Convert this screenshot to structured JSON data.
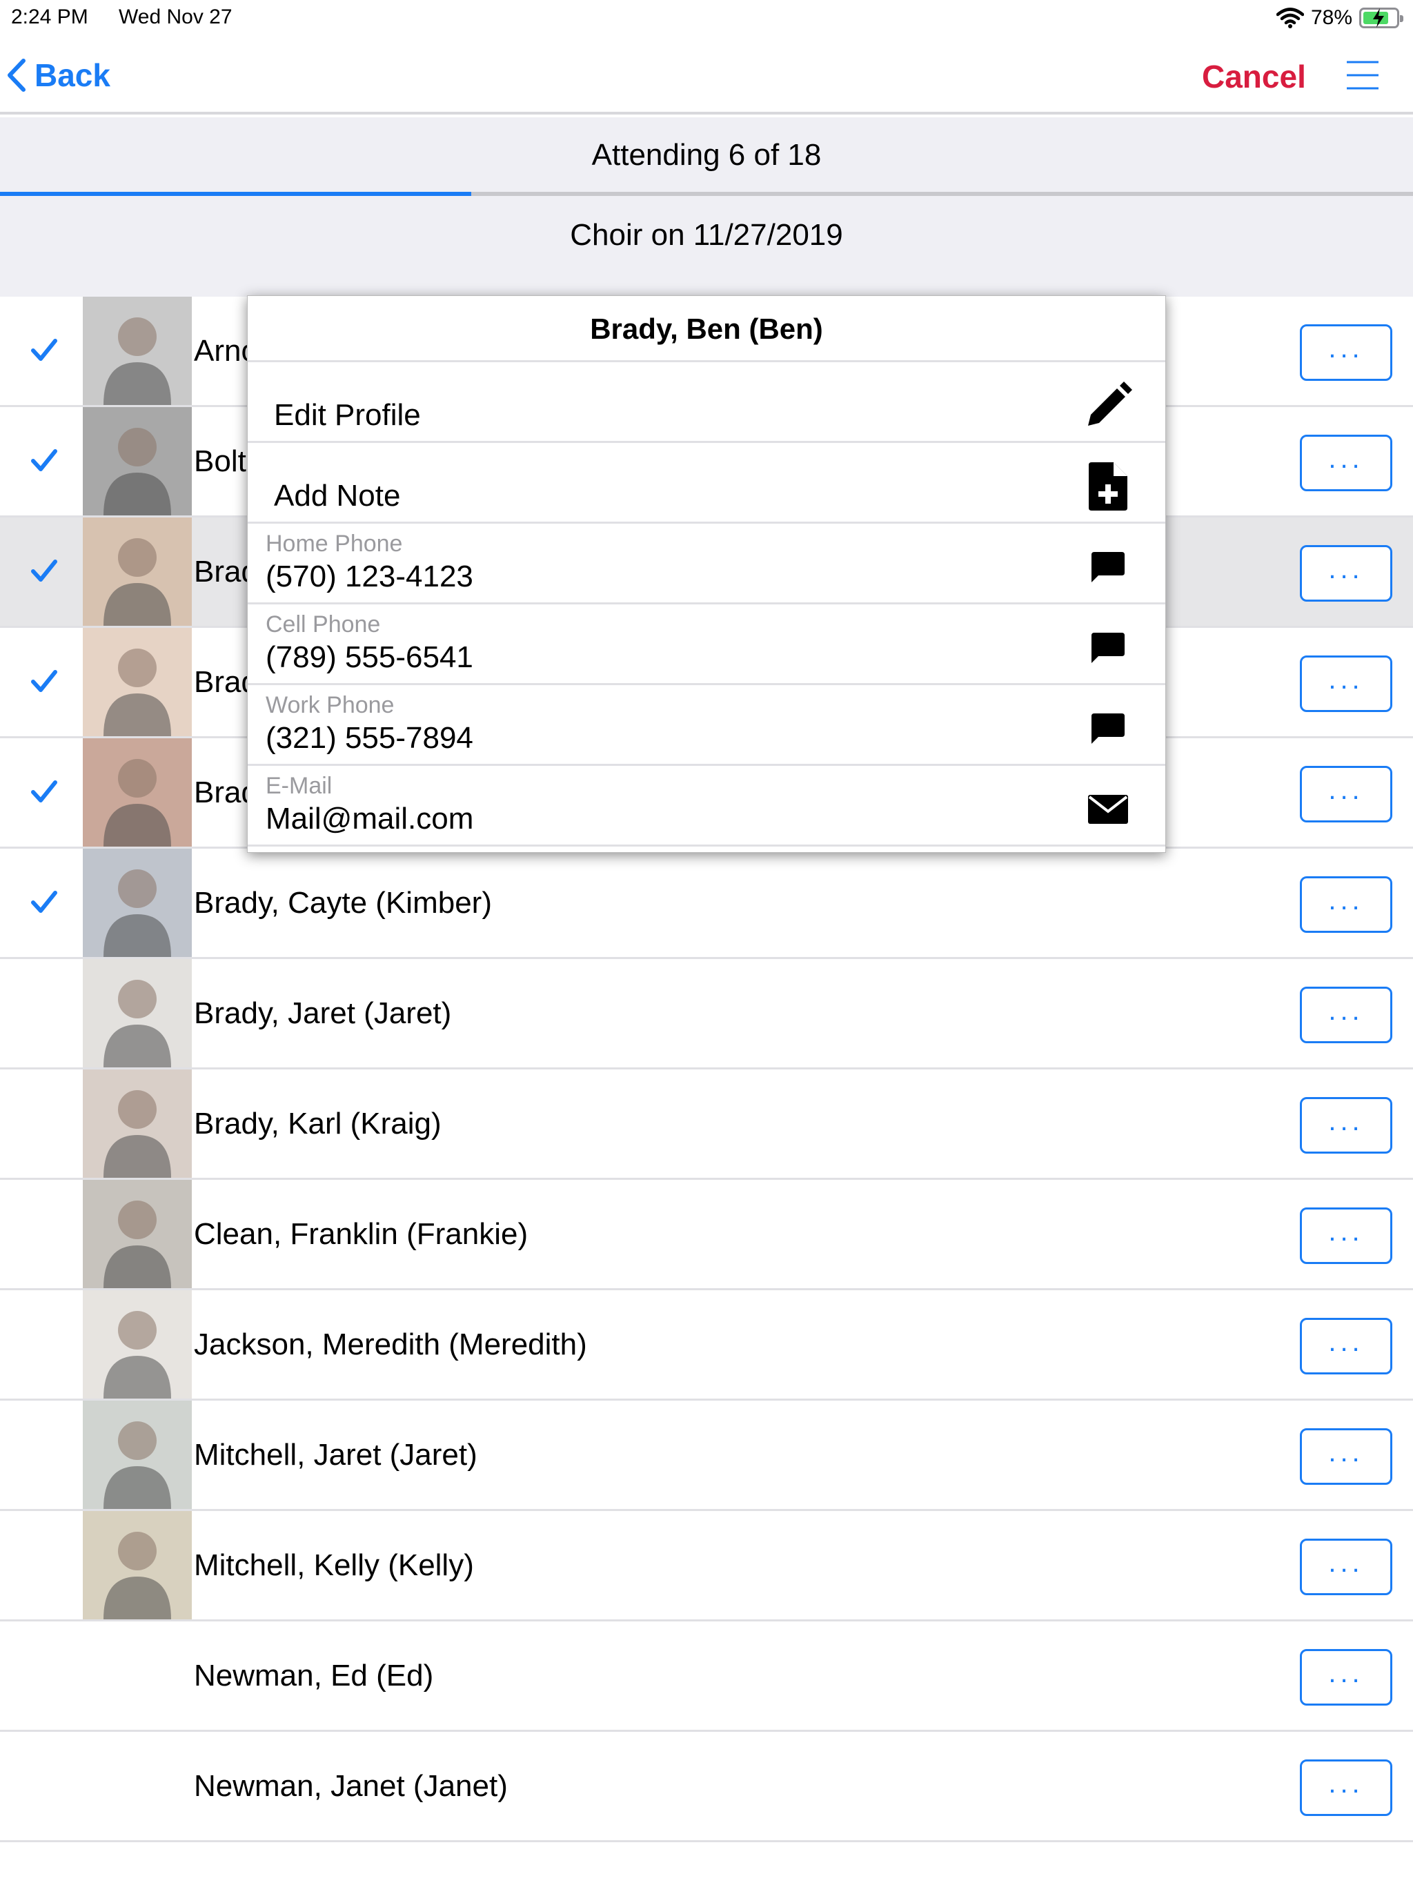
{
  "status_bar": {
    "time": "2:24 PM",
    "date": "Wed Nov 27",
    "battery": "78%"
  },
  "nav": {
    "back_label": "Back",
    "cancel_label": "Cancel",
    "accent": "#1a7cf5",
    "cancel_color": "#d81d3f"
  },
  "header": {
    "attending": "Attending 6 of 18",
    "event": "Choir on 11/27/2019",
    "progress_fraction": 0.3333
  },
  "people": [
    {
      "name": "Arnold",
      "checked": true
    },
    {
      "name": "Bolt",
      "checked": true
    },
    {
      "name": "Brady, Ben (Ben)",
      "checked": true
    },
    {
      "name": "Brady",
      "checked": true
    },
    {
      "name": "Brady",
      "checked": true
    },
    {
      "name": "Brady, Cayte (Kimber)",
      "checked": true
    },
    {
      "name": "Brady, Jaret (Jaret)",
      "checked": false
    },
    {
      "name": "Brady, Karl (Kraig)",
      "checked": false
    },
    {
      "name": "Clean, Franklin (Frankie)",
      "checked": false
    },
    {
      "name": "Jackson, Meredith (Meredith)",
      "checked": false
    },
    {
      "name": "Mitchell, Jaret (Jaret)",
      "checked": false
    },
    {
      "name": "Mitchell, Kelly (Kelly)",
      "checked": false
    },
    {
      "name": "Newman, Ed (Ed)",
      "checked": false
    },
    {
      "name": "Newman, Janet (Janet)",
      "checked": false
    }
  ],
  "more_label": "...",
  "popover": {
    "title": "Brady, Ben (Ben)",
    "edit_profile": "Edit Profile",
    "add_note": "Add Note",
    "home_phone_label": "Home Phone",
    "home_phone": "(570) 123-4123",
    "cell_phone_label": "Cell Phone",
    "cell_phone": "(789) 555-6541",
    "work_phone_label": "Work Phone",
    "work_phone": "(321) 555-7894",
    "email_label": "E-Mail",
    "email": "Mail@mail.com"
  }
}
